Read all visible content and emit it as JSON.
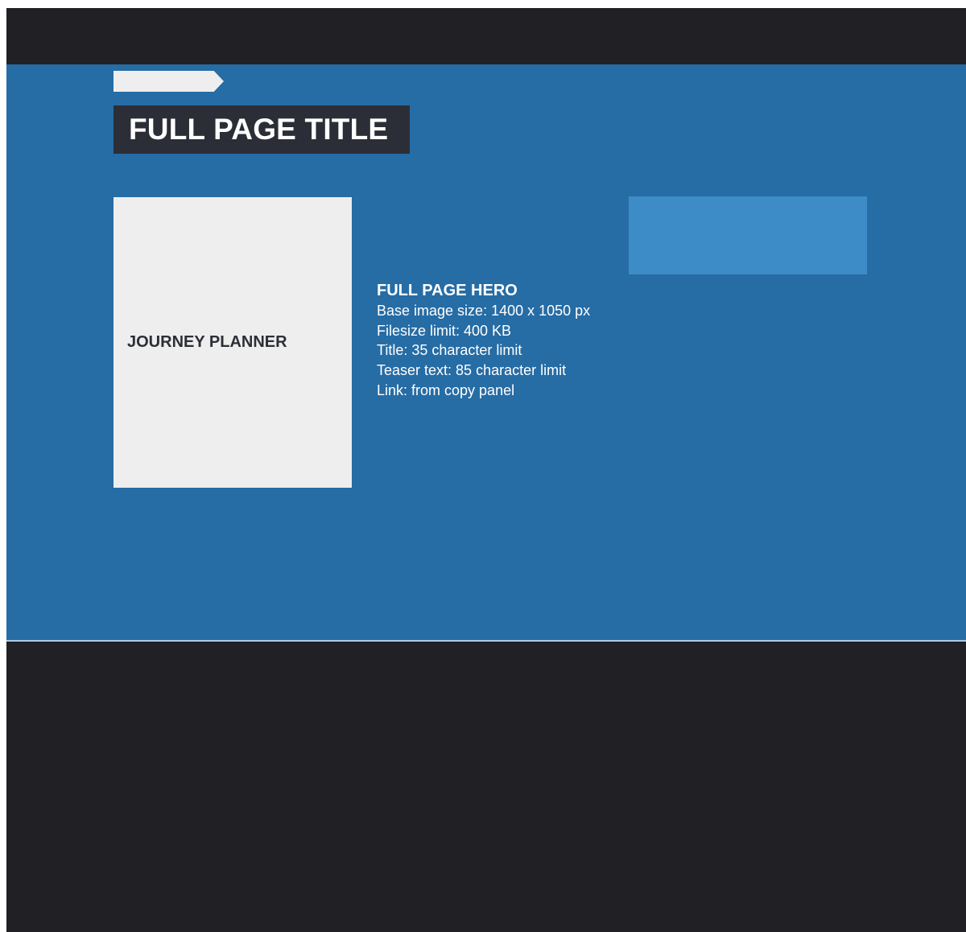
{
  "page": {
    "title": "FULL PAGE TITLE"
  },
  "journey_planner": {
    "label": "JOURNEY PLANNER"
  },
  "hero_spec": {
    "heading": "FULL PAGE HERO",
    "lines": [
      "Base image size: 1400 x 1050 px",
      "Filesize limit: 400 KB",
      "Title: 35 character limit",
      "Teaser text: 85 character limit",
      "Link: from copy panel"
    ]
  },
  "colors": {
    "header_bar": "#212025",
    "hero_background": "#266ca5",
    "title_box": "#2c2e37",
    "card_background": "#eeeeee",
    "light_panel": "#3e8cc7",
    "footer_area": "#212025"
  }
}
